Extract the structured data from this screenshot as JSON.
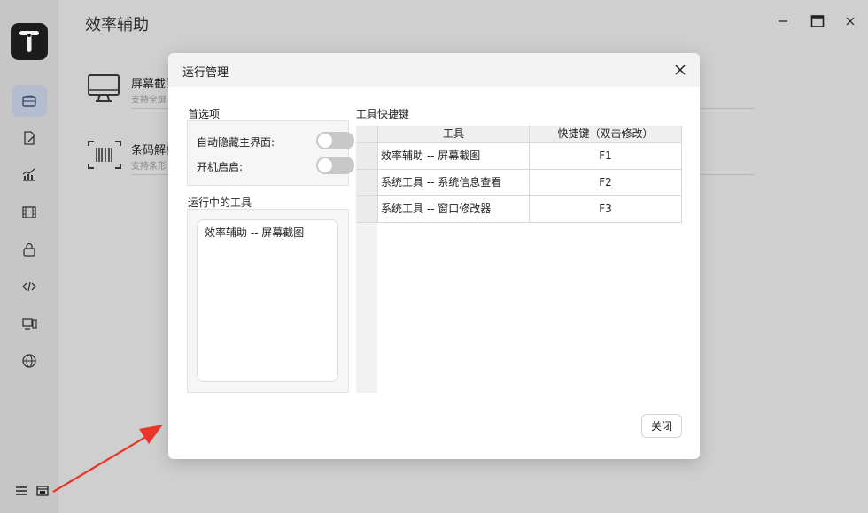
{
  "app": {
    "title": "效率辅助",
    "features": [
      {
        "name": "屏幕截图",
        "desc": "支持全屏"
      },
      {
        "name": "条码解析",
        "desc": "支持条形"
      }
    ]
  },
  "dialog": {
    "title": "运行管理",
    "preferences_label": "首选项",
    "toggles": [
      {
        "label": "自动隐藏主界面:",
        "on": false
      },
      {
        "label": "开机启启:",
        "on": false
      }
    ],
    "running_label": "运行中的工具",
    "running_tools": [
      "效率辅助 -- 屏幕截图"
    ],
    "shortcuts_label": "工具快捷键",
    "table": {
      "headers": [
        "工具",
        "快捷键（双击修改）"
      ],
      "rows": [
        {
          "tool": "效率辅助 -- 屏幕截图",
          "key": "F1"
        },
        {
          "tool": "系统工具 -- 系统信息查看",
          "key": "F2"
        },
        {
          "tool": "系统工具 -- 窗口修改器",
          "key": "F3"
        }
      ]
    },
    "close_label": "关闭"
  },
  "colors": {
    "annotation_arrow": "#e8372a",
    "sidebar_active": "#b4bcd0"
  }
}
